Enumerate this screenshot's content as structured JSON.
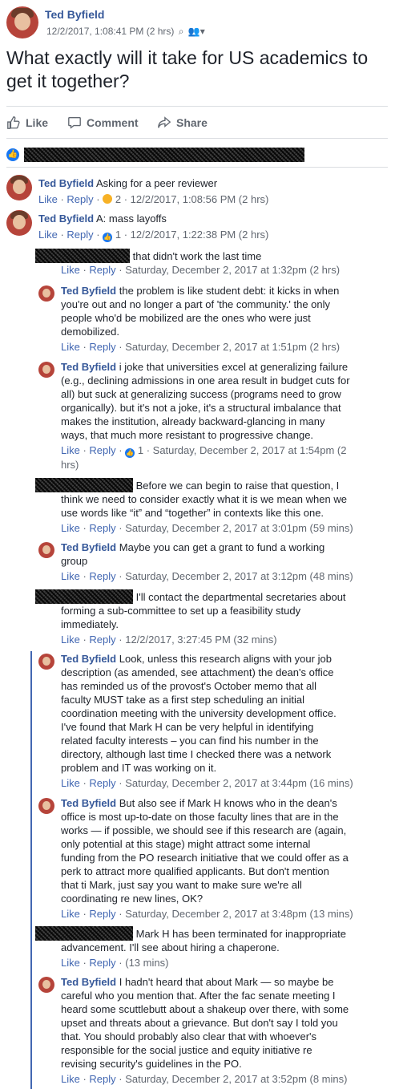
{
  "post": {
    "author": "Ted Byfield",
    "timestamp": "12/2/2017, 1:08:41 PM (2 hrs)",
    "text": "What exactly will it take for US academics to get it together?"
  },
  "actions": {
    "like": "Like",
    "comment": "Comment",
    "share": "Share"
  },
  "comments": [
    {
      "author": "Ted Byfield",
      "text": "Asking for a peer reviewer",
      "like": "Like",
      "reply": "Reply",
      "reaction_count": "2",
      "time": "12/2/2017, 1:08:56 PM (2 hrs)"
    },
    {
      "author": "Ted Byfield",
      "text": "A: mass layoffs",
      "like": "Like",
      "reply": "Reply",
      "reaction_count": "1",
      "time": "12/2/2017, 1:22:38 PM (2 hrs)"
    }
  ],
  "replies": [
    {
      "author": "",
      "text": "that didn't work the last time",
      "line2": "",
      "like": "Like",
      "reply": "Reply",
      "time": "Saturday, December 2, 2017 at 1:32pm (2 hrs)"
    },
    {
      "author": "Ted Byfield",
      "text": "the problem is like student debt: it kicks in when",
      "lines": [
        "you're out and no longer a part of 'the community.' the only",
        "people who'd be mobilized are the ones who were just",
        "demobilized."
      ],
      "like": "Like",
      "reply": "Reply",
      "time": "Saturday, December 2, 2017 at 1:51pm (2 hrs)"
    },
    {
      "author": "Ted Byfield",
      "text": "i joke that universities excel at generalizing failure",
      "lines": [
        "(e.g., declining admissions in one area result in budget cuts for",
        "all) but suck at generalizing success (programs need to grow",
        "organically). but it's not a joke, it's a structural imbalance that",
        "makes the institution, already backward-glancing in many",
        "ways, that much more resistant to progressive change."
      ],
      "like": "Like",
      "reply": "Reply",
      "reaction_count": "1",
      "time": "Saturday, December 2, 2017 at 1:54pm (2",
      "time2": "hrs)"
    },
    {
      "author": "",
      "text": "Before we can begin to raise that question, I",
      "lines": [
        "think we need to consider exactly what it is we mean when we",
        "use words like “it” and “together” in contexts like this one."
      ],
      "like": "Like",
      "reply": "Reply",
      "time": "Saturday, December 2, 2017 at 3:01pm (59 mins)"
    },
    {
      "author": "Ted Byfield",
      "text": "Maybe you can get a grant to fund a working",
      "lines": [
        "group"
      ],
      "like": "Like",
      "reply": "Reply",
      "time": "Saturday, December 2, 2017 at 3:12pm (48 mins)"
    },
    {
      "author": "",
      "text": "I'll contact the departmental secretaries about",
      "lines": [
        "forming a sub-committee to set up a feasibility study",
        "immediately."
      ],
      "like": "Like",
      "reply": "Reply",
      "time": "12/2/2017, 3:27:45 PM (32 mins)"
    },
    {
      "author": "Ted Byfield",
      "text": "Look, unless this research aligns with your job",
      "lines": [
        "description (as amended, see attachment) the dean's office",
        "has reminded us of the provost's October memo that all",
        "faculty MUST take as a first step scheduling an initial",
        "coordination meeting with the university development office.",
        "I've found that Mark H can be very helpful in identifying",
        "related faculty interests – you can find his number in the",
        "directory, although last time I checked there was a network",
        "problem and IT was working on it."
      ],
      "like": "Like",
      "reply": "Reply",
      "time": "Saturday, December 2, 2017 at 3:44pm (16 mins)"
    },
    {
      "author": "Ted Byfield",
      "text": "But also see if Mark H knows who in the dean's",
      "lines": [
        "office is most up-to-date on those faculty lines that are in the",
        "works — if possible, we should see if this research are (again,",
        "only potential at this stage) might attract some internal",
        "funding from the PO research initiative that we could offer as a",
        "perk to attract more qualified applicants. But don't mention",
        "that ti Mark, just say you want to make sure we're all",
        "coordinating re new lines, OK?"
      ],
      "like": "Like",
      "reply": "Reply",
      "time": "Saturday, December 2, 2017 at 3:48pm (13 mins)"
    },
    {
      "author": "",
      "text": "Mark H has been terminated for inappropriate",
      "lines": [
        "advancement. I'll see about hiring a chaperone."
      ],
      "like": "Like",
      "reply": "Reply",
      "time": "(13 mins)"
    },
    {
      "author": "Ted Byfield",
      "text": "I hadn't heard that about Mark — so maybe be",
      "lines": [
        "careful who you mention that. After the fac senate meeting I",
        "heard some scuttlebutt about a shakeup over there, with some",
        "upset and threats about a grievance. But don't say I told you",
        "that. You should probably also clear that with whoever's",
        "responsible for the social justice and equity initiative re",
        "revising security's guidelines in the PO."
      ],
      "like": "Like",
      "reply": "Reply",
      "time": "Saturday, December 2, 2017 at 3:52pm (8 mins)"
    }
  ]
}
